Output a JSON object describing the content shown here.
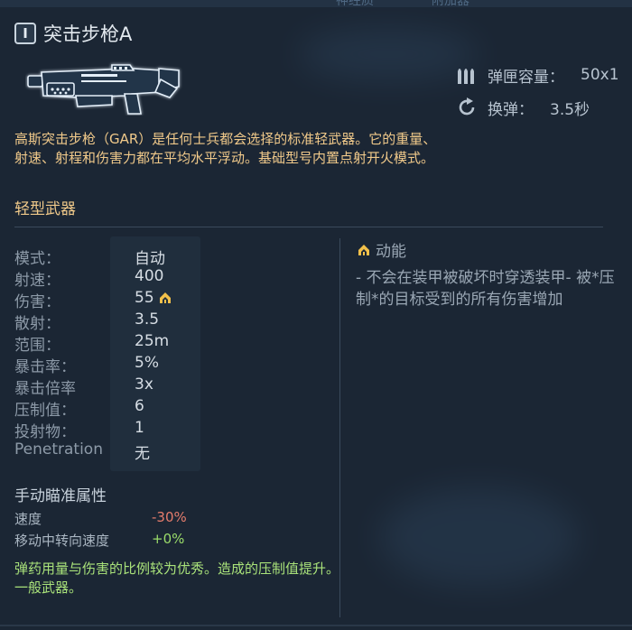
{
  "top_tabs": [
    "神经质",
    "附加器"
  ],
  "weapon": {
    "tier": "I",
    "name": "突击步枪A",
    "description": "高斯突击步枪（GAR）是任何士兵都会选择的标准轻武器。它的重量、射速、射程和伤害力都在平均水平浮动。基础型号内置点射开火模式。",
    "category": "轻型武器"
  },
  "top_stats": [
    {
      "icon": "ammo-icon",
      "label": "弹匣容量：",
      "value": "50x1"
    },
    {
      "icon": "reload-icon",
      "label": "换弹：",
      "value": "3.5秒"
    }
  ],
  "stats": [
    {
      "label": "模式：",
      "value": "自动"
    },
    {
      "label": "射速：",
      "value": "400"
    },
    {
      "label": "伤害：",
      "value": "55",
      "icon": "kinetic-damage-icon"
    },
    {
      "label": "散射：",
      "value": "3.5"
    },
    {
      "label": "范围：",
      "value": "25m"
    },
    {
      "label": "暴击率：",
      "value": "5%"
    },
    {
      "label": "暴击倍率",
      "value": "3x"
    },
    {
      "label": "压制值：",
      "value": "6"
    },
    {
      "label": "投射物：",
      "value": "1"
    },
    {
      "label": "Penetration",
      "value": "无"
    }
  ],
  "ability": {
    "title": "动能",
    "icon": "kinetic-damage-icon",
    "description": "- 不会在装甲被破坏时穿透装甲- 被*压制*的目标受到的所有伤害增加"
  },
  "manual_aim": {
    "title": "手动瞄准属性",
    "rows": [
      {
        "label": "速度",
        "value": "-30%"
      },
      {
        "label": "移动中转向速度",
        "value": "+0%"
      }
    ]
  },
  "notes": {
    "line1": "弹药用量与伤害的比例较为优秀。造成的压制值提升。",
    "line2": "一般武器。"
  },
  "colors": {
    "background": "#1b2634",
    "accent_orange": "#f0c98a",
    "negative": "#e47c6c",
    "positive": "#9bdc6a",
    "note_green": "#a9e27a"
  }
}
